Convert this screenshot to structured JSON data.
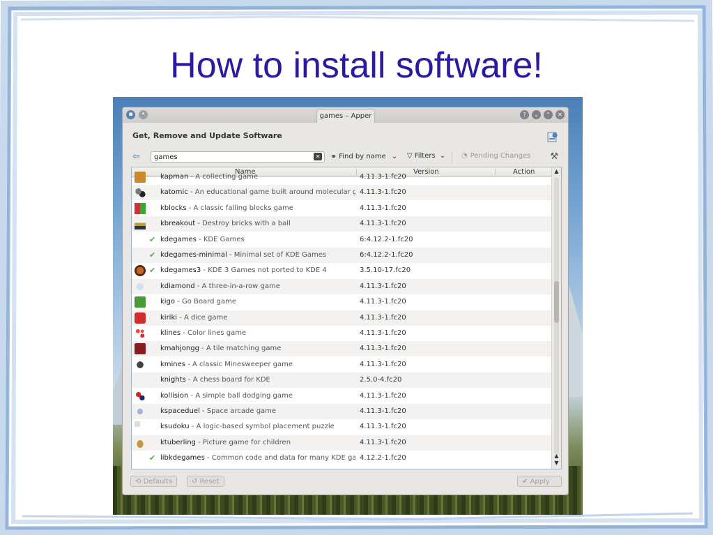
{
  "slide": {
    "title": "How to install software!"
  },
  "window": {
    "title": "games – Apper",
    "header": "Get, Remove and Update Software",
    "toolbar": {
      "search_value": "games",
      "find_by_label": "Find by name",
      "filters_label": "Filters",
      "pending_label": "Pending Changes"
    },
    "table": {
      "columns": [
        "Name",
        "Version",
        "Action"
      ],
      "rows": [
        {
          "name": "kapman",
          "desc": " - A collecting game",
          "version": "4.11.3-1.fc20",
          "installed": false,
          "icon": "pacman-icon"
        },
        {
          "name": "katomic",
          "desc": " - An educational game built around molecular g",
          "version": "4.11.3-1.fc20",
          "installed": false,
          "icon": "atom-icon"
        },
        {
          "name": "kblocks",
          "desc": " - A classic falling blocks game",
          "version": "4.11.3-1.fc20",
          "installed": false,
          "icon": "blocks-icon"
        },
        {
          "name": "kbreakout",
          "desc": " - Destroy bricks with a ball",
          "version": "4.11.3-1.fc20",
          "installed": false,
          "icon": "breakout-icon"
        },
        {
          "name": "kdegames",
          "desc": " - KDE Games",
          "version": "6:4.12.2-1.fc20",
          "installed": true,
          "icon": ""
        },
        {
          "name": "kdegames-minimal",
          "desc": " - Minimal set of KDE Games",
          "version": "6:4.12.2-1.fc20",
          "installed": true,
          "icon": ""
        },
        {
          "name": "kdegames3",
          "desc": " - KDE 3 Games not ported to KDE 4",
          "version": "3.5.10-17.fc20",
          "installed": true,
          "icon": "kde3-icon"
        },
        {
          "name": "kdiamond",
          "desc": " - A three-in-a-row game",
          "version": "4.11.3-1.fc20",
          "installed": false,
          "icon": "diamond-icon"
        },
        {
          "name": "kigo",
          "desc": " - Go Board game",
          "version": "4.11.3-1.fc20",
          "installed": false,
          "icon": "go-board-icon"
        },
        {
          "name": "kiriki",
          "desc": " - A dice game",
          "version": "4.11.3-1.fc20",
          "installed": false,
          "icon": "dice-icon"
        },
        {
          "name": "klines",
          "desc": " - Color lines game",
          "version": "4.11.3-1.fc20",
          "installed": false,
          "icon": "lines-icon"
        },
        {
          "name": "kmahjongg",
          "desc": " - A tile matching game",
          "version": "4.11.3-1.fc20",
          "installed": false,
          "icon": "mahjong-icon"
        },
        {
          "name": "kmines",
          "desc": " - A classic Minesweeper game",
          "version": "4.11.3-1.fc20",
          "installed": false,
          "icon": "mine-icon"
        },
        {
          "name": "knights",
          "desc": " - A chess board for KDE",
          "version": "2.5.0-4.fc20",
          "installed": false,
          "icon": ""
        },
        {
          "name": "kollision",
          "desc": " - A simple ball dodging game",
          "version": "4.11.3-1.fc20",
          "installed": false,
          "icon": "balls-icon"
        },
        {
          "name": "kspaceduel",
          "desc": " - Space arcade game",
          "version": "4.11.3-1.fc20",
          "installed": false,
          "icon": "spaceship-icon"
        },
        {
          "name": "ksudoku",
          "desc": " - A logic-based symbol placement puzzle",
          "version": "4.11.3-1.fc20",
          "installed": false,
          "icon": "sudoku-icon"
        },
        {
          "name": "ktuberling",
          "desc": " - Picture game for children",
          "version": "4.11.3-1.fc20",
          "installed": false,
          "icon": "potato-icon"
        },
        {
          "name": "libkdegames",
          "desc": " - Common code and data for many KDE ga",
          "version": "4.12.2-1.fc20",
          "installed": true,
          "icon": ""
        }
      ]
    },
    "buttons": {
      "defaults": "Defaults",
      "reset": "Reset",
      "apply": "Apply"
    }
  },
  "colors": {
    "title": "#2a1aa0",
    "installed_check": "#58a34a",
    "frame": "#8fb0d8"
  }
}
